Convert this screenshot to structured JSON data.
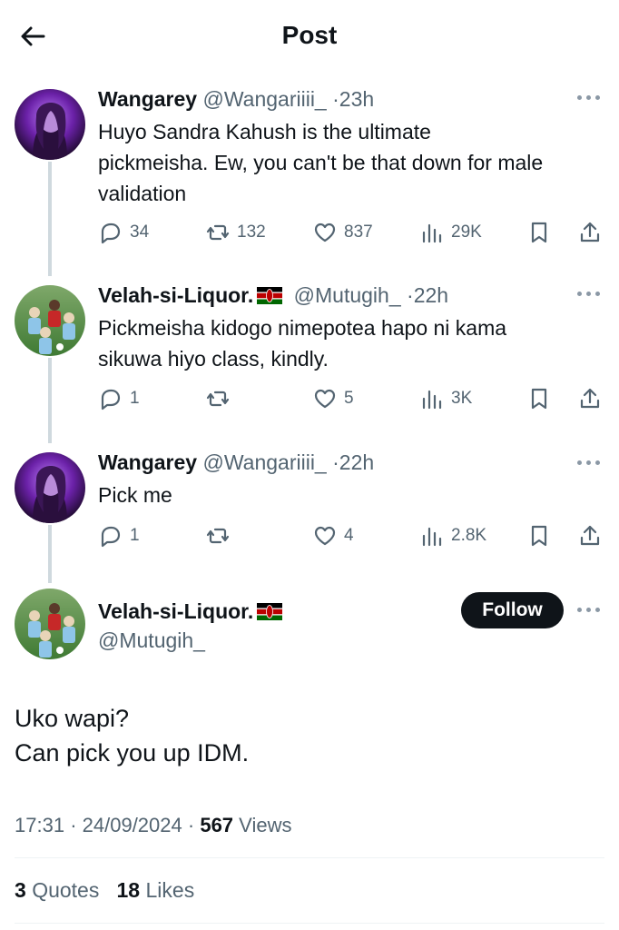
{
  "header": {
    "title": "Post"
  },
  "replies": [
    {
      "name": "Wangarey",
      "handle": "@Wangariiii_",
      "time": "23h",
      "text_lines": [
        "Huyo Sandra Kahush is the ultimate",
        "pickmeisha. Ew, you can't be that down for male",
        "validation"
      ],
      "avatar": "avatar-purple-portrait",
      "flag": false,
      "reply_count": "34",
      "retweet_count": "132",
      "like_count": "837",
      "view_count": "29K"
    },
    {
      "name": "Velah-si-Liquor.",
      "handle": "@Mutugih_",
      "time": "22h",
      "text_lines": [
        "Pickmeisha kidogo nimepotea hapo ni kama",
        "sikuwa hiyo class, kindly."
      ],
      "avatar": "avatar-football-players",
      "flag": true,
      "reply_count": "1",
      "retweet_count": "",
      "like_count": "5",
      "view_count": "3K"
    },
    {
      "name": "Wangarey",
      "handle": "@Wangariiii_",
      "time": "22h",
      "text_lines": [
        "Pick me"
      ],
      "avatar": "avatar-purple-portrait",
      "flag": false,
      "reply_count": "1",
      "retweet_count": "",
      "like_count": "4",
      "view_count": "2.8K"
    }
  ],
  "main_post": {
    "name": "Velah-si-Liquor.",
    "handle": "@Mutugih_",
    "follow_label": "Follow",
    "text_lines": [
      "Uko wapi?",
      "Can pick you up IDM."
    ],
    "time": "17:31",
    "date": "24/09/2024",
    "views_count": "567",
    "views_label": "Views",
    "quotes_count": "3",
    "quotes_label": "Quotes",
    "likes_count": "18",
    "likes_label": "Likes"
  },
  "separator": "·",
  "colors": {
    "text": "#0f1419",
    "secondary": "#536471",
    "thread": "#cfd9de",
    "follow_bg": "#0f1419",
    "flag_green": "#006600",
    "flag_red": "#bb0000"
  }
}
